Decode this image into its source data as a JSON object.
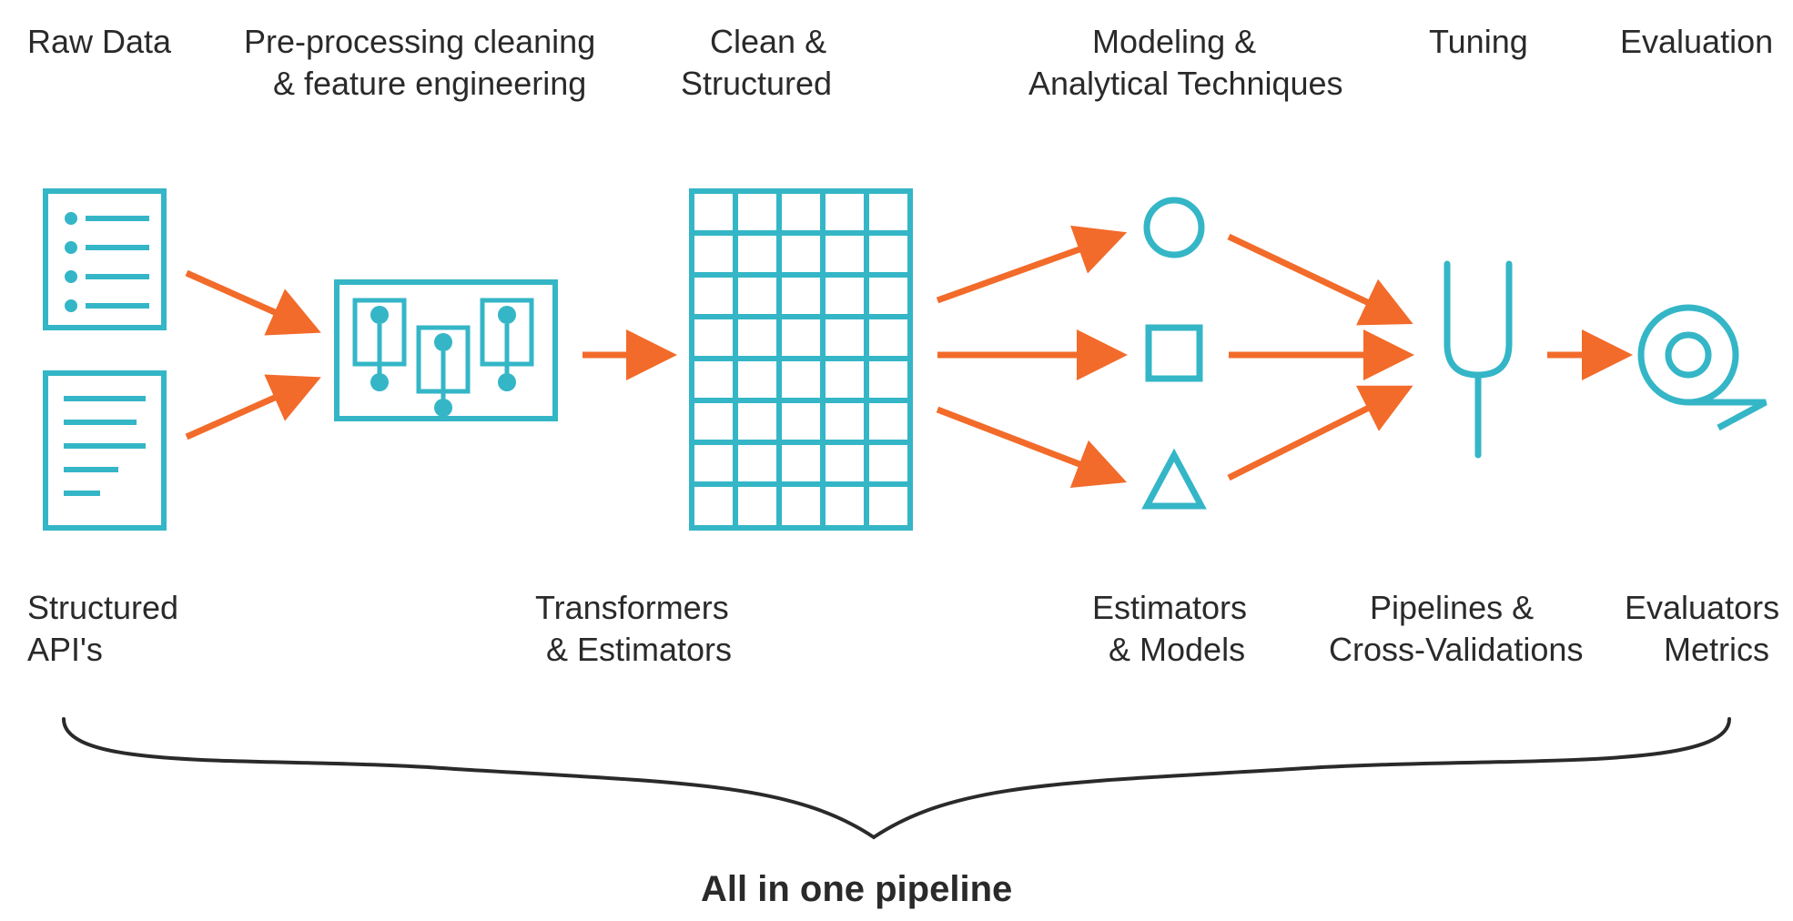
{
  "colors": {
    "teal": "#34b6c7",
    "orange": "#f26b2a",
    "text": "#2a2a2a"
  },
  "top_labels": {
    "raw_data": "Raw Data",
    "preprocessing_l1": "Pre-processing cleaning",
    "preprocessing_l2": "& feature engineering",
    "clean_l1": "Clean &",
    "clean_l2": "Structured",
    "modeling_l1": "Modeling &",
    "modeling_l2": "Analytical Techniques",
    "tuning": "Tuning",
    "evaluation": "Evaluation"
  },
  "bottom_labels": {
    "structured_l1": "Structured",
    "structured_l2": "API's",
    "transformers_l1": "Transformers",
    "transformers_l2": "& Estimators",
    "estimators_l1": "Estimators",
    "estimators_l2": "& Models",
    "pipelines_l1": "Pipelines &",
    "pipelines_l2": "Cross-Validations",
    "evaluators_l1": "Evaluators",
    "evaluators_l2": "Metrics"
  },
  "footer": "All in one pipeline"
}
